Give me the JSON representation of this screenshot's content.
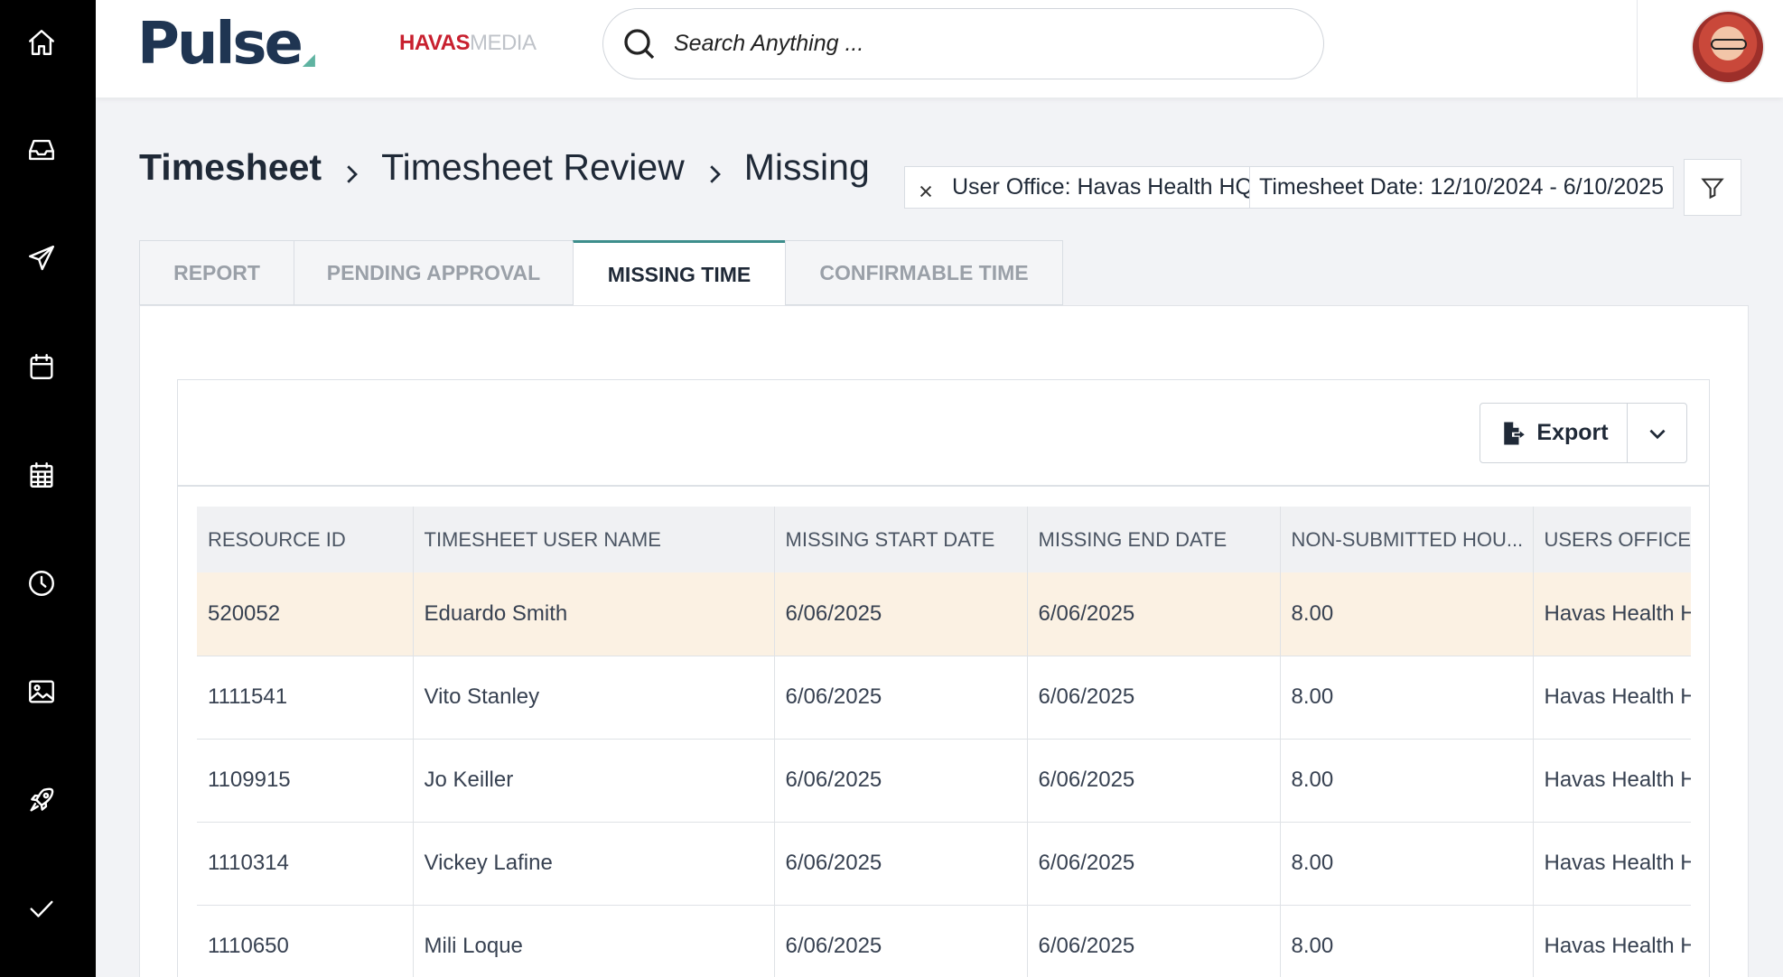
{
  "sidebar": {
    "items": [
      {
        "icon": "home-icon"
      },
      {
        "icon": "inbox-icon"
      },
      {
        "icon": "send-icon"
      },
      {
        "icon": "calendar-icon"
      },
      {
        "icon": "calendar-grid-icon"
      },
      {
        "icon": "clock-icon"
      },
      {
        "icon": "image-icon"
      },
      {
        "icon": "rocket-icon"
      },
      {
        "icon": "check-icon"
      }
    ]
  },
  "header": {
    "logo": "Pulse",
    "partner_logo_part1": "HAVAS",
    "partner_logo_part2": "MEDIA",
    "search_placeholder": "Search Anything ..."
  },
  "breadcrumb": {
    "items": [
      "Timesheet",
      "Timesheet Review",
      "Missing"
    ]
  },
  "filters": {
    "chips": [
      "User Office: Havas Health HQ",
      "Timesheet Date: 12/10/2024 - 6/10/2025"
    ]
  },
  "tabs": [
    {
      "label": "REPORT",
      "active": false
    },
    {
      "label": "PENDING APPROVAL",
      "active": false
    },
    {
      "label": "MISSING TIME",
      "active": true
    },
    {
      "label": "CONFIRMABLE TIME",
      "active": false
    }
  ],
  "toolbar": {
    "export_label": "Export"
  },
  "table": {
    "columns": [
      "RESOURCE ID",
      "TIMESHEET USER NAME",
      "MISSING START DATE",
      "MISSING END DATE",
      "NON-SUBMITTED HOU...",
      "USERS OFFICE"
    ],
    "rows": [
      [
        "520052",
        "Eduardo Smith",
        "6/06/2025",
        "6/06/2025",
        "8.00",
        "Havas Health HQ"
      ],
      [
        "1111541",
        "Vito Stanley",
        "6/06/2025",
        "6/06/2025",
        "8.00",
        "Havas Health HQ"
      ],
      [
        "1109915",
        "Jo Keiller",
        "6/06/2025",
        "6/06/2025",
        "8.00",
        "Havas Health HQ"
      ],
      [
        "1110314",
        "Vickey Lafine",
        "6/06/2025",
        "6/06/2025",
        "8.00",
        "Havas Health HQ"
      ],
      [
        "1110650",
        "Mili Loque",
        "6/06/2025",
        "6/06/2025",
        "8.00",
        "Havas Health HQ"
      ]
    ],
    "highlighted_row": 0
  },
  "colors": {
    "sidebar_bg": "#000000",
    "accent": "#3d8e8c",
    "row_highlight": "#fbf1e3",
    "brand": "#1f3552"
  }
}
